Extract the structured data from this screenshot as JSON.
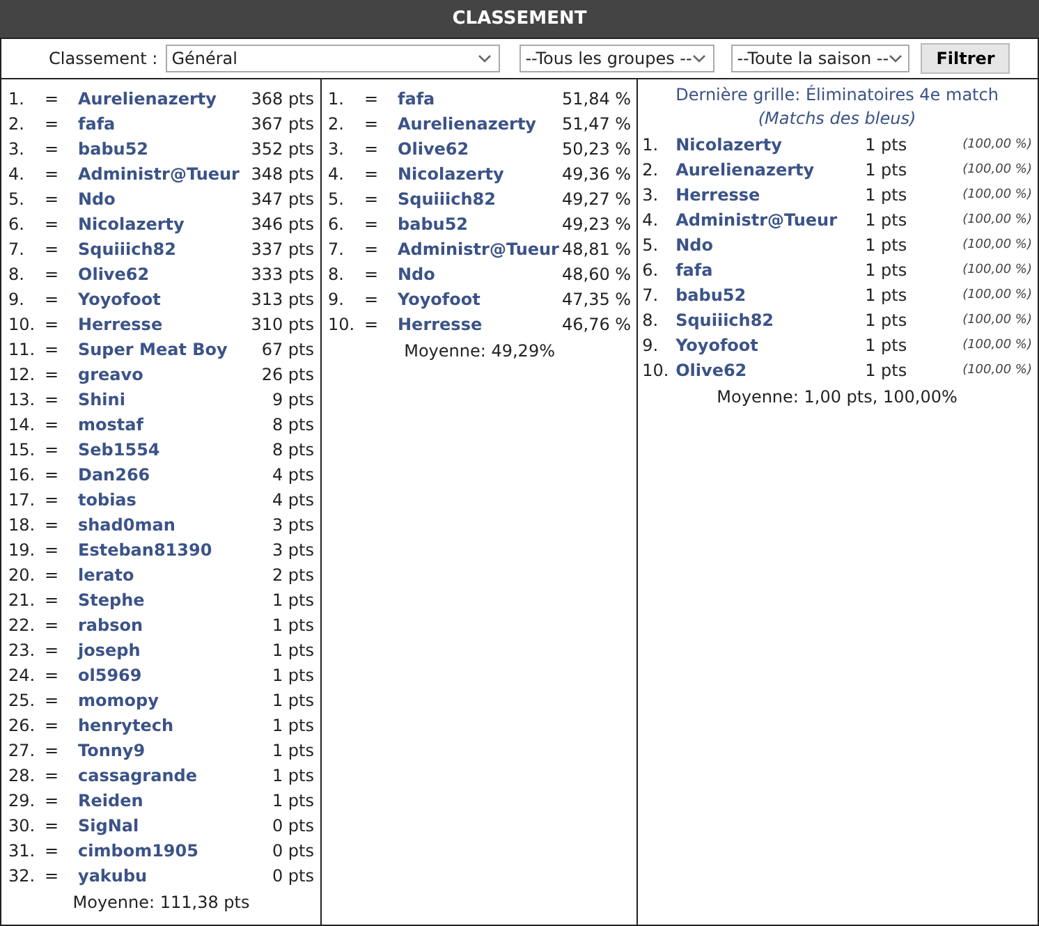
{
  "header": {
    "title": "CLASSEMENT"
  },
  "filters": {
    "label": "Classement :",
    "selects": [
      {
        "value": "Général",
        "kind": "wide"
      },
      {
        "value": "--Tous les groupes --",
        "kind": "mid"
      },
      {
        "value": "--Toute la saison --",
        "kind": "small"
      }
    ],
    "button": "Filtrer"
  },
  "points_ranking": {
    "rows": [
      {
        "rank": "1.",
        "trend": "=",
        "name": "Aurelienazerty",
        "score": "368 pts"
      },
      {
        "rank": "2.",
        "trend": "=",
        "name": "fafa",
        "score": "367 pts"
      },
      {
        "rank": "3.",
        "trend": "=",
        "name": "babu52",
        "score": "352 pts"
      },
      {
        "rank": "4.",
        "trend": "=",
        "name": "Administr@Tueur",
        "score": "348 pts"
      },
      {
        "rank": "5.",
        "trend": "=",
        "name": "Ndo",
        "score": "347 pts"
      },
      {
        "rank": "6.",
        "trend": "=",
        "name": "Nicolazerty",
        "score": "346 pts"
      },
      {
        "rank": "7.",
        "trend": "=",
        "name": "Squiiich82",
        "score": "337 pts"
      },
      {
        "rank": "8.",
        "trend": "=",
        "name": "Olive62",
        "score": "333 pts"
      },
      {
        "rank": "9.",
        "trend": "=",
        "name": "Yoyofoot",
        "score": "313 pts"
      },
      {
        "rank": "10.",
        "trend": "=",
        "name": "Herresse",
        "score": "310 pts"
      },
      {
        "rank": "11.",
        "trend": "=",
        "name": "Super Meat Boy",
        "score": "67 pts"
      },
      {
        "rank": "12.",
        "trend": "=",
        "name": "greavo",
        "score": "26 pts"
      },
      {
        "rank": "13.",
        "trend": "=",
        "name": "Shini",
        "score": "9 pts"
      },
      {
        "rank": "14.",
        "trend": "=",
        "name": "mostaf",
        "score": "8 pts"
      },
      {
        "rank": "15.",
        "trend": "=",
        "name": "Seb1554",
        "score": "8 pts"
      },
      {
        "rank": "16.",
        "trend": "=",
        "name": "Dan266",
        "score": "4 pts"
      },
      {
        "rank": "17.",
        "trend": "=",
        "name": "tobias",
        "score": "4 pts"
      },
      {
        "rank": "18.",
        "trend": "=",
        "name": "shad0man",
        "score": "3 pts"
      },
      {
        "rank": "19.",
        "trend": "=",
        "name": "Esteban81390",
        "score": "3 pts"
      },
      {
        "rank": "20.",
        "trend": "=",
        "name": "lerato",
        "score": "2 pts"
      },
      {
        "rank": "21.",
        "trend": "=",
        "name": "Stephe",
        "score": "1 pts"
      },
      {
        "rank": "22.",
        "trend": "=",
        "name": "rabson",
        "score": "1 pts"
      },
      {
        "rank": "23.",
        "trend": "=",
        "name": "joseph",
        "score": "1 pts"
      },
      {
        "rank": "24.",
        "trend": "=",
        "name": "ol5969",
        "score": "1 pts"
      },
      {
        "rank": "25.",
        "trend": "=",
        "name": "momopy",
        "score": "1 pts"
      },
      {
        "rank": "26.",
        "trend": "=",
        "name": "henrytech",
        "score": "1 pts"
      },
      {
        "rank": "27.",
        "trend": "=",
        "name": "Tonny9",
        "score": "1 pts"
      },
      {
        "rank": "28.",
        "trend": "=",
        "name": "cassagrande",
        "score": "1 pts"
      },
      {
        "rank": "29.",
        "trend": "=",
        "name": "Reiden",
        "score": "1 pts"
      },
      {
        "rank": "30.",
        "trend": "=",
        "name": "SigNal",
        "score": "0 pts"
      },
      {
        "rank": "31.",
        "trend": "=",
        "name": "cimbom1905",
        "score": "0 pts"
      },
      {
        "rank": "32.",
        "trend": "=",
        "name": "yakubu",
        "score": "0 pts"
      }
    ],
    "average": "Moyenne: 111,38 pts"
  },
  "percent_ranking": {
    "rows": [
      {
        "rank": "1.",
        "trend": "=",
        "name": "fafa",
        "score": "51,84 %"
      },
      {
        "rank": "2.",
        "trend": "=",
        "name": "Aurelienazerty",
        "score": "51,47 %"
      },
      {
        "rank": "3.",
        "trend": "=",
        "name": "Olive62",
        "score": "50,23 %"
      },
      {
        "rank": "4.",
        "trend": "=",
        "name": "Nicolazerty",
        "score": "49,36 %"
      },
      {
        "rank": "5.",
        "trend": "=",
        "name": "Squiiich82",
        "score": "49,27 %"
      },
      {
        "rank": "6.",
        "trend": "=",
        "name": "babu52",
        "score": "49,23 %"
      },
      {
        "rank": "7.",
        "trend": "=",
        "name": "Administr@Tueur",
        "score": "48,81 %"
      },
      {
        "rank": "8.",
        "trend": "=",
        "name": "Ndo",
        "score": "48,60 %"
      },
      {
        "rank": "9.",
        "trend": "=",
        "name": "Yoyofoot",
        "score": "47,35 %"
      },
      {
        "rank": "10.",
        "trend": "=",
        "name": "Herresse",
        "score": "46,76 %"
      }
    ],
    "average": "Moyenne: 49,29%"
  },
  "last_grid": {
    "title": "Dernière grille: Éliminatoires 4e match *(Matchs des bleus)*",
    "rows": [
      {
        "rank": "1.",
        "name": "Nicolazerty",
        "score": "1 pts",
        "percent": "(100,00 %)"
      },
      {
        "rank": "2.",
        "name": "Aurelienazerty",
        "score": "1 pts",
        "percent": "(100,00 %)"
      },
      {
        "rank": "3.",
        "name": "Herresse",
        "score": "1 pts",
        "percent": "(100,00 %)"
      },
      {
        "rank": "4.",
        "name": "Administr@Tueur",
        "score": "1 pts",
        "percent": "(100,00 %)"
      },
      {
        "rank": "5.",
        "name": "Ndo",
        "score": "1 pts",
        "percent": "(100,00 %)"
      },
      {
        "rank": "6.",
        "name": "fafa",
        "score": "1 pts",
        "percent": "(100,00 %)"
      },
      {
        "rank": "7.",
        "name": "babu52",
        "score": "1 pts",
        "percent": "(100,00 %)"
      },
      {
        "rank": "8.",
        "name": "Squiiich82",
        "score": "1 pts",
        "percent": "(100,00 %)"
      },
      {
        "rank": "9.",
        "name": "Yoyofoot",
        "score": "1 pts",
        "percent": "(100,00 %)"
      },
      {
        "rank": "10.",
        "name": "Olive62",
        "score": "1 pts",
        "percent": "(100,00 %)"
      }
    ],
    "average": "Moyenne: 1,00 pts, 100,00%"
  }
}
